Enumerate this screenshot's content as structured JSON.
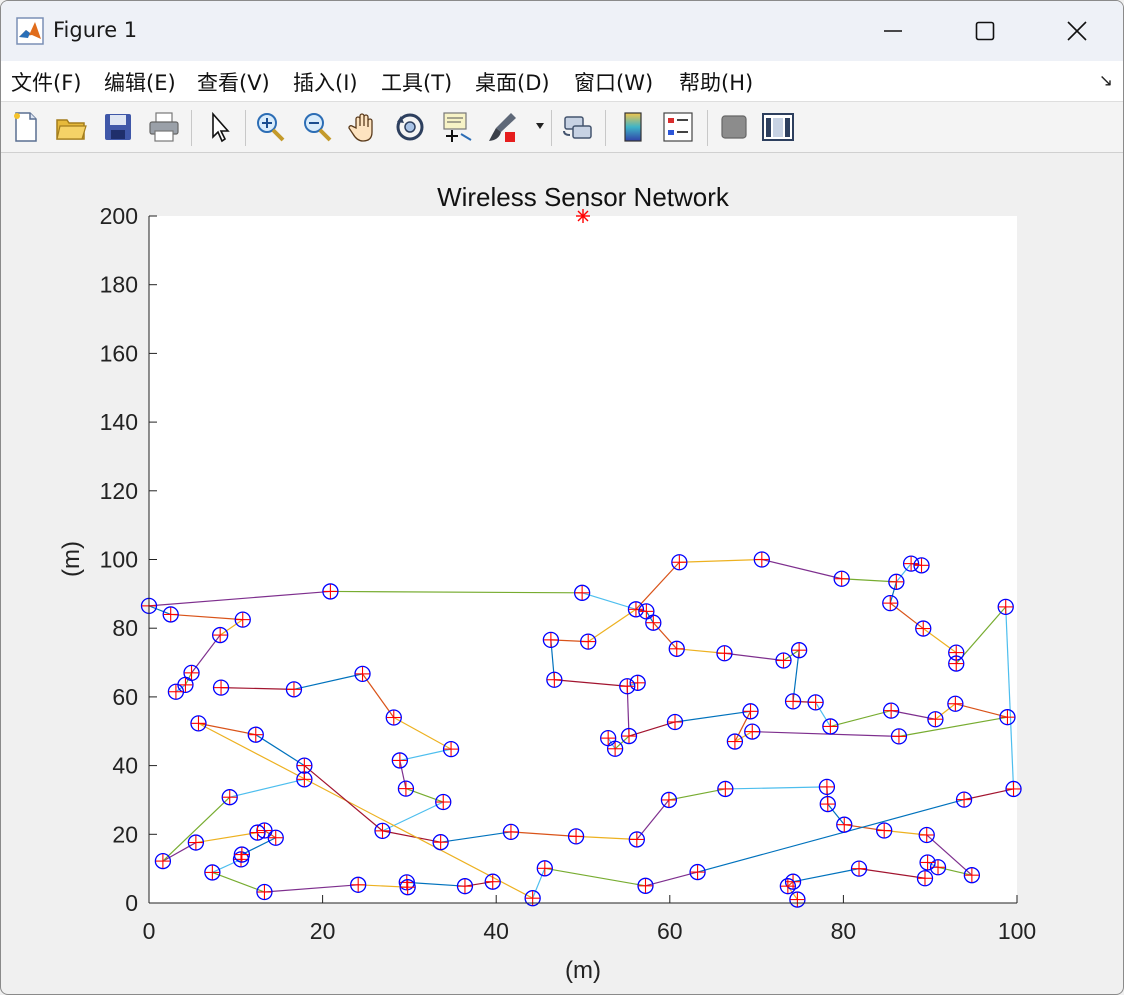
{
  "window": {
    "title": "Figure 1",
    "app_icon": "matlab-icon",
    "controls": {
      "minimize_icon": "minimize-icon",
      "maximize_icon": "maximize-icon",
      "close_icon": "close-icon"
    }
  },
  "menu": {
    "items": [
      "文件(F)",
      "编辑(E)",
      "查看(V)",
      "插入(I)",
      "工具(T)",
      "桌面(D)",
      "窗口(W)",
      "帮助(H)"
    ],
    "corner_icon": "dock-arrow-icon"
  },
  "toolbar": {
    "buttons": [
      "new-figure-icon",
      "open-file-icon",
      "save-icon",
      "print-icon",
      "pointer-icon",
      "zoom-in-icon",
      "zoom-out-icon",
      "pan-hand-icon",
      "rotate-3d-icon",
      "data-cursor-icon",
      "brush-icon",
      "link-plot-icon",
      "colorbar-icon",
      "legend-icon",
      "hide-plot-tools-icon",
      "show-plot-tools-icon"
    ]
  },
  "colors": {
    "node_circle": "#0000ff",
    "node_plus": "#ff0000",
    "sink": "#ff0000",
    "link_palette": [
      "#0072bd",
      "#d95319",
      "#edb120",
      "#7e2f8e",
      "#77ac30",
      "#4dbeee",
      "#a2142f"
    ]
  },
  "chart_data": {
    "type": "scatter",
    "title": "Wireless Sensor Network",
    "xlabel": "(m)",
    "ylabel": "(m)",
    "xlim": [
      0,
      100
    ],
    "ylim": [
      0,
      200
    ],
    "xticks": [
      "0",
      "20",
      "40",
      "60",
      "80",
      "100"
    ],
    "yticks": [
      "0",
      "20",
      "40",
      "60",
      "80",
      "100",
      "120",
      "140",
      "160",
      "180",
      "200"
    ],
    "grid": false,
    "sink": {
      "x": 50,
      "y": 200,
      "marker": "*"
    },
    "nodes": [
      [
        0,
        86.5
      ],
      [
        2.5,
        84
      ],
      [
        10.8,
        82.5
      ],
      [
        8.2,
        78
      ],
      [
        4.9,
        67
      ],
      [
        4.2,
        63.5
      ],
      [
        3.1,
        61.5
      ],
      [
        8.3,
        62.7
      ],
      [
        16.7,
        62.2
      ],
      [
        24.6,
        66.7
      ],
      [
        28.2,
        54
      ],
      [
        34.8,
        44.8
      ],
      [
        28.9,
        41.5
      ],
      [
        29.6,
        33.3
      ],
      [
        33.9,
        29.4
      ],
      [
        26.9,
        21
      ],
      [
        33.6,
        17.7
      ],
      [
        41.7,
        20.7
      ],
      [
        49.2,
        19.4
      ],
      [
        56.2,
        18.5
      ],
      [
        59.9,
        30
      ],
      [
        66.4,
        33.2
      ],
      [
        78.1,
        33.8
      ],
      [
        78.2,
        28.8
      ],
      [
        80.1,
        22.8
      ],
      [
        84.7,
        21.1
      ],
      [
        89.6,
        19.8
      ],
      [
        94.8,
        8.1
      ],
      [
        90.9,
        10.4
      ],
      [
        89.7,
        11.8
      ],
      [
        89.4,
        7.2
      ],
      [
        81.8,
        10
      ],
      [
        74.2,
        6.2
      ],
      [
        73.6,
        4.9
      ],
      [
        74.7,
        1
      ],
      [
        63.2,
        9
      ],
      [
        57.2,
        5
      ],
      [
        45.6,
        10.1
      ],
      [
        44.2,
        1.4
      ],
      [
        39.6,
        6.2
      ],
      [
        36.4,
        4.9
      ],
      [
        29.7,
        6
      ],
      [
        29.8,
        4.6
      ],
      [
        24.1,
        5.3
      ],
      [
        13.3,
        3.2
      ],
      [
        7.3,
        8.9
      ],
      [
        10.6,
        12.7
      ],
      [
        10.7,
        14.1
      ],
      [
        14.6,
        19
      ],
      [
        13.3,
        21.1
      ],
      [
        12.5,
        20.5
      ],
      [
        5.4,
        17.6
      ],
      [
        1.6,
        12.2
      ],
      [
        9.3,
        30.8
      ],
      [
        17.9,
        36
      ],
      [
        17.9,
        40
      ],
      [
        12.3,
        49
      ],
      [
        5.7,
        52.3
      ],
      [
        20.9,
        90.7
      ],
      [
        49.9,
        90.3
      ],
      [
        56.1,
        85.5
      ],
      [
        57.3,
        84.9
      ],
      [
        58.1,
        81.6
      ],
      [
        61.1,
        99.2
      ],
      [
        70.6,
        100
      ],
      [
        79.8,
        94.4
      ],
      [
        86.1,
        93.5
      ],
      [
        87.8,
        98.8
      ],
      [
        89,
        98.3
      ],
      [
        85.4,
        87.3
      ],
      [
        89.2,
        79.9
      ],
      [
        93,
        72.9
      ],
      [
        93,
        69.7
      ],
      [
        98.7,
        86.2
      ],
      [
        99.6,
        33.2
      ],
      [
        93.9,
        30.1
      ],
      [
        98.9,
        54.1
      ],
      [
        92.9,
        58
      ],
      [
        90.6,
        53.5
      ],
      [
        85.5,
        56
      ],
      [
        78.5,
        51.4
      ],
      [
        76.8,
        58.4
      ],
      [
        74.2,
        58.7
      ],
      [
        74.9,
        73.6
      ],
      [
        73.1,
        70.6
      ],
      [
        66.3,
        72.7
      ],
      [
        60.8,
        74
      ],
      [
        56.3,
        64.1
      ],
      [
        55.1,
        63.1
      ],
      [
        46.7,
        65
      ],
      [
        46.3,
        76.6
      ],
      [
        50.6,
        76.1
      ],
      [
        55.3,
        48.6
      ],
      [
        53.7,
        44.9
      ],
      [
        52.9,
        48
      ],
      [
        60.6,
        52.7
      ],
      [
        69.3,
        55.8
      ],
      [
        67.5,
        47
      ],
      [
        69.5,
        49.9
      ],
      [
        86.4,
        48.5
      ]
    ],
    "links": [
      [
        0,
        1
      ],
      [
        1,
        2
      ],
      [
        2,
        3
      ],
      [
        3,
        4
      ],
      [
        4,
        5
      ],
      [
        5,
        6
      ],
      [
        7,
        8
      ],
      [
        8,
        9
      ],
      [
        9,
        10
      ],
      [
        10,
        11
      ],
      [
        12,
        13
      ],
      [
        13,
        14
      ],
      [
        14,
        15
      ],
      [
        15,
        16
      ],
      [
        16,
        17
      ],
      [
        17,
        18
      ],
      [
        18,
        19
      ],
      [
        19,
        20
      ],
      [
        20,
        21
      ],
      [
        21,
        22
      ],
      [
        22,
        23
      ],
      [
        23,
        24
      ],
      [
        24,
        25
      ],
      [
        25,
        26
      ],
      [
        26,
        27
      ],
      [
        27,
        28
      ],
      [
        28,
        29
      ],
      [
        30,
        31
      ],
      [
        31,
        32
      ],
      [
        32,
        33
      ],
      [
        33,
        34
      ],
      [
        35,
        36
      ],
      [
        36,
        37
      ],
      [
        37,
        38
      ],
      [
        39,
        40
      ],
      [
        40,
        41
      ],
      [
        41,
        42
      ],
      [
        42,
        43
      ],
      [
        43,
        44
      ],
      [
        44,
        45
      ],
      [
        45,
        46
      ],
      [
        46,
        47
      ],
      [
        47,
        48
      ],
      [
        48,
        49
      ],
      [
        50,
        51
      ],
      [
        51,
        52
      ],
      [
        52,
        53
      ],
      [
        53,
        54
      ],
      [
        54,
        55
      ],
      [
        55,
        56
      ],
      [
        56,
        57
      ],
      [
        57,
        38
      ],
      [
        0,
        58
      ],
      [
        58,
        59
      ],
      [
        59,
        60
      ],
      [
        60,
        61
      ],
      [
        61,
        62
      ],
      [
        60,
        63
      ],
      [
        63,
        64
      ],
      [
        64,
        65
      ],
      [
        65,
        66
      ],
      [
        66,
        67
      ],
      [
        67,
        68
      ],
      [
        66,
        69
      ],
      [
        69,
        70
      ],
      [
        70,
        71
      ],
      [
        71,
        72
      ],
      [
        72,
        73
      ],
      [
        73,
        74
      ],
      [
        74,
        75
      ],
      [
        75,
        35
      ],
      [
        76,
        77
      ],
      [
        77,
        78
      ],
      [
        78,
        79
      ],
      [
        79,
        80
      ],
      [
        80,
        81
      ],
      [
        81,
        82
      ],
      [
        82,
        83
      ],
      [
        62,
        86
      ],
      [
        86,
        85
      ],
      [
        85,
        84
      ],
      [
        84,
        83
      ],
      [
        87,
        88
      ],
      [
        88,
        89
      ],
      [
        89,
        90
      ],
      [
        90,
        91
      ],
      [
        91,
        60
      ],
      [
        88,
        92
      ],
      [
        92,
        93
      ],
      [
        93,
        94
      ],
      [
        92,
        95
      ],
      [
        95,
        96
      ],
      [
        96,
        97
      ],
      [
        97,
        98
      ],
      [
        98,
        99
      ],
      [
        99,
        76
      ],
      [
        12,
        11
      ],
      [
        15,
        55
      ]
    ]
  }
}
